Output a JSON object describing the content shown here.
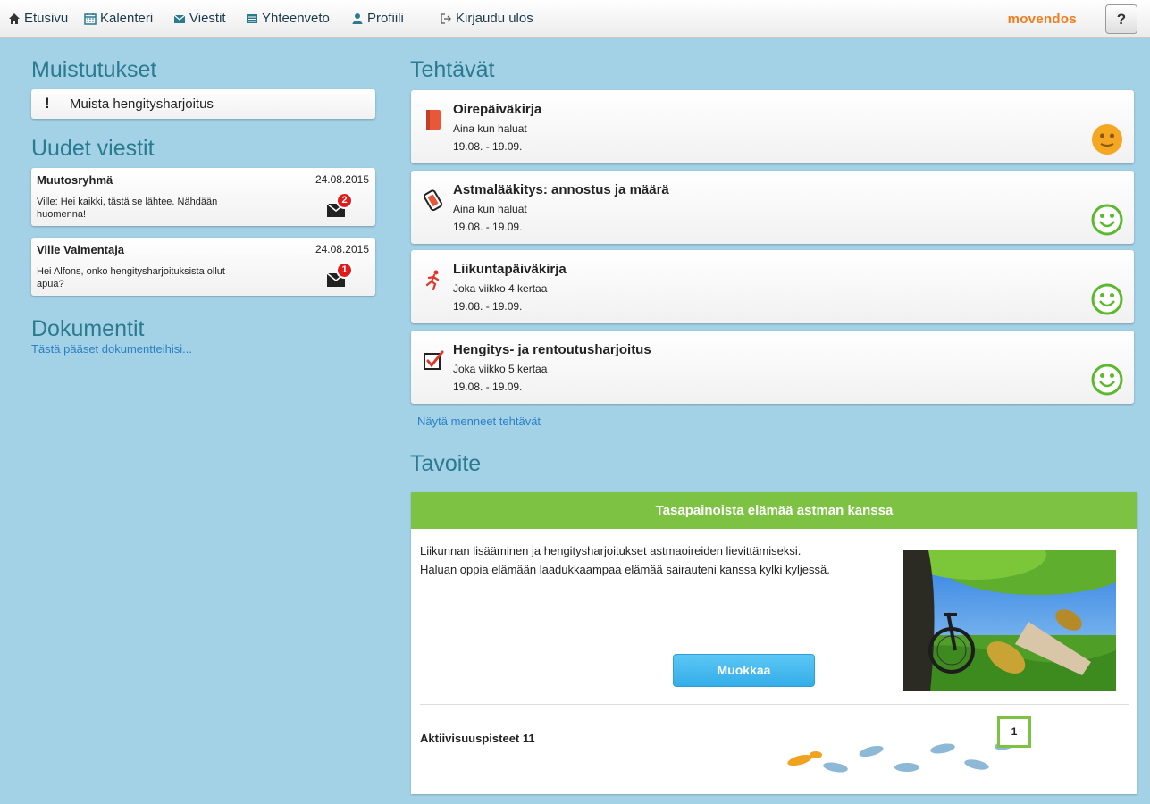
{
  "nav": {
    "home": "Etusivu",
    "calendar": "Kalenteri",
    "messages": "Viestit",
    "summary": "Yhteenveto",
    "profile": "Profiili",
    "logout": "Kirjaudu ulos",
    "brand": "movendos",
    "help": "?"
  },
  "reminders": {
    "title": "Muistutukset",
    "items": [
      {
        "icon": "exclamation-icon",
        "text": "Muista hengitysharjoitus"
      }
    ]
  },
  "messages": {
    "title": "Uudet viestit",
    "items": [
      {
        "from": "Muutosryhmä",
        "date": "24.08.2015",
        "body": "Ville: Hei kaikki, tästä se lähtee. Nähdään huomenna!",
        "unread": "2"
      },
      {
        "from": "Ville Valmentaja",
        "date": "24.08.2015",
        "body": "Hei Alfons, onko hengitysharjoituksista ollut apua?",
        "unread": "1"
      }
    ]
  },
  "documents": {
    "title": "Dokumentit",
    "link": "Tästä pääset dokumentteihisi..."
  },
  "tasks": {
    "title": "Tehtävät",
    "items": [
      {
        "name": "Oirepäiväkirja",
        "frequency": "Aina kun haluat",
        "dates": "19.08. - 19.09.",
        "icon": "book-icon",
        "mood": "neutral",
        "mood_color": "#f5a623"
      },
      {
        "name": "Astmalääkitys: annostus ja määrä",
        "frequency": "Aina kun haluat",
        "dates": "19.08. - 19.09.",
        "icon": "inhaler-icon",
        "mood": "happy",
        "mood_color": "#5cb82e"
      },
      {
        "name": "Liikuntapäiväkirja",
        "frequency": "Joka viikko 4 kertaa",
        "dates": "19.08. - 19.09.",
        "icon": "runner-icon",
        "mood": "happy",
        "mood_color": "#5cb82e"
      },
      {
        "name": "Hengitys- ja rentoutusharjoitus",
        "frequency": "Joka viikko 5 kertaa",
        "dates": "19.08. - 19.09.",
        "icon": "checkbox-icon",
        "mood": "happy",
        "mood_color": "#5cb82e"
      }
    ],
    "past_link": "Näytä menneet tehtävät"
  },
  "goal": {
    "title": "Tavoite",
    "header": "Tasapainoista elämää astman kanssa",
    "line1": "Liikunnan lisääminen ja hengitysharjoitukset astmaoireiden lievittämiseksi.",
    "line2": "Haluan oppia elämään laadukkaampaa elämää sairauteni kanssa kylki kyljessä.",
    "edit_button": "Muokkaa",
    "points_label": "Aktiivisuuspisteet 11",
    "points_marker": "1"
  },
  "colors": {
    "background": "#a3d1e6",
    "heading": "#2a7a90",
    "goal_green": "#7dc242",
    "button_blue": "#34aee8",
    "brand_orange": "#f07d1e",
    "link": "#2c7fc5"
  }
}
